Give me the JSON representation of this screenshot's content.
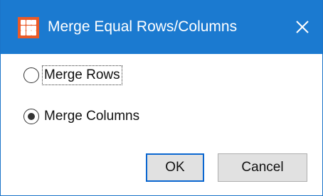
{
  "window": {
    "title": "Merge Equal Rows/Columns",
    "icon": "app-grid-icon",
    "close_icon": "close-icon",
    "titlebar_color": "#1b7ad0",
    "icon_color": "#ea5a27"
  },
  "options": {
    "merge_rows_label": "Merge Rows",
    "merge_columns_label": "Merge Columns",
    "selected": "merge_columns"
  },
  "buttons": {
    "ok_label": "OK",
    "cancel_label": "Cancel",
    "default_border_color": "#0a66d0"
  }
}
